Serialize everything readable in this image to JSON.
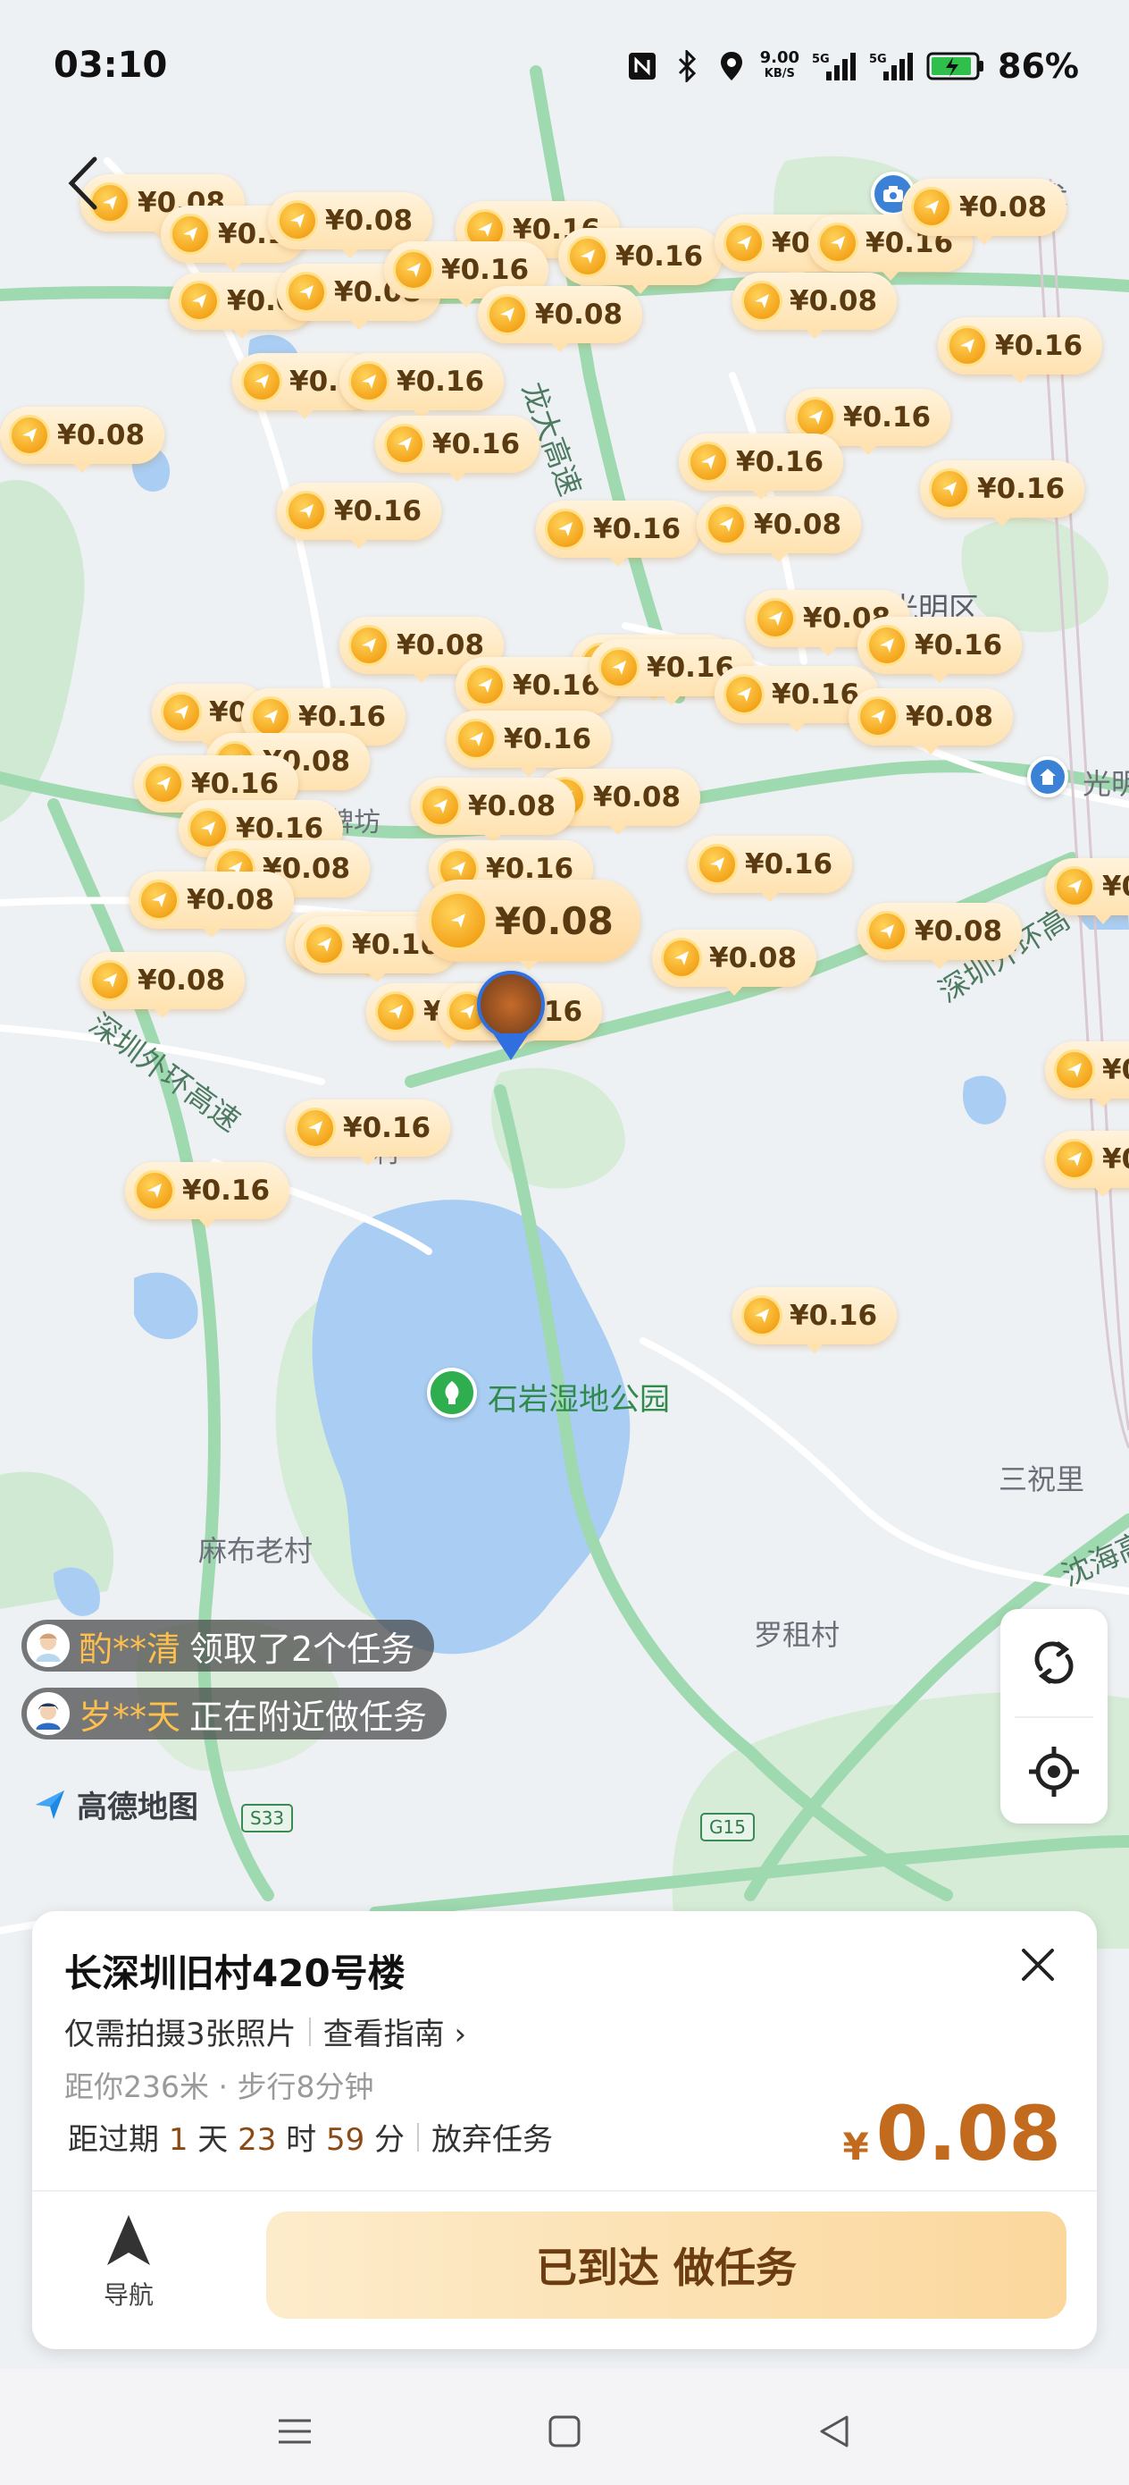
{
  "status_bar": {
    "time": "03:10",
    "net_speed_value": "9.00",
    "net_speed_unit": "KB/S",
    "signal1_label": "5G",
    "signal2_label": "5G",
    "battery": "86%"
  },
  "map": {
    "places": {
      "guangming": "光明区",
      "guangming_partial": "光明",
      "shiyan_park": "石岩湿地公园",
      "mabu": "麻布老村",
      "luozu": "罗租村",
      "sanzhuli": "三祝里",
      "tech_partial": "学技术",
      "guangming_road": "光明",
      "keji_partial": "客牌坊",
      "zhucun_partial": "村"
    },
    "roads": {
      "longda": "龙大高速",
      "waihuan_right": "深圳外环高",
      "waihuan_left": "深圳外环高速",
      "yanhai": "沈海高"
    },
    "shields": {
      "s33": "S33",
      "g15": "G15"
    },
    "bubbles": [
      "¥0.08",
      "¥0.1",
      "¥0.08",
      "¥0.16",
      "¥0.16",
      "¥0.16",
      "¥0.0",
      "¥0.08",
      "¥0.16",
      "¥0.08",
      "¥0.16",
      "¥0.08",
      "¥0.0",
      "¥0.16",
      "¥0.08",
      "¥0.16",
      "¥0.16",
      "¥0.08",
      "¥0.16",
      "¥0.16",
      "¥0.16",
      "¥0.08",
      "¥0.16",
      "¥0.16",
      "¥0.08",
      "¥0.16",
      "¥0.08",
      "¥0.16",
      "¥0.16",
      "¥0.16",
      "¥0",
      "¥0.16",
      "¥0.16",
      "¥0.16",
      "¥0.08",
      "¥0.08",
      "¥0.16",
      "¥0.08",
      "¥0.16",
      "¥0.08",
      "¥0.08",
      "¥0.16",
      "¥0.16",
      "¥0.08",
      "¥0.08",
      "¥0.08",
      "¥0.08",
      "¥0.16",
      "¥0.16",
      "¥0.16",
      "¥0.16",
      "¥0.08",
      "¥0",
      "¥0.16",
      "¥0",
      "¥0",
      "¥0.16"
    ],
    "featured_bubble": "¥0.08"
  },
  "tickers": [
    {
      "name": "酌**清",
      "text": "领取了2个任务"
    },
    {
      "name": "岁**天",
      "text": "正在附近做任务"
    }
  ],
  "logo_text": "高德地图",
  "card": {
    "title": "长深圳旧村420号楼",
    "requirement": "仅需拍摄3张照片",
    "guide_link": "查看指南 ›",
    "distance": "距你236米 · 步行8分钟",
    "expire_prefix": "距过期",
    "expire_days": "1",
    "expire_days_unit": "天",
    "expire_hours": "23",
    "expire_hours_unit": "时",
    "expire_minutes": "59",
    "expire_minutes_unit": "分",
    "abandon": "放弃任务",
    "price_symbol": "¥",
    "price": "0.08",
    "nav_label": "导航",
    "cta": "已到达 做任务"
  },
  "colors": {
    "accent": "#c26a1e",
    "bubble": "#ffe2b0",
    "ticker_name": "#ffbf4d",
    "user_ring": "#2f6fe0"
  }
}
